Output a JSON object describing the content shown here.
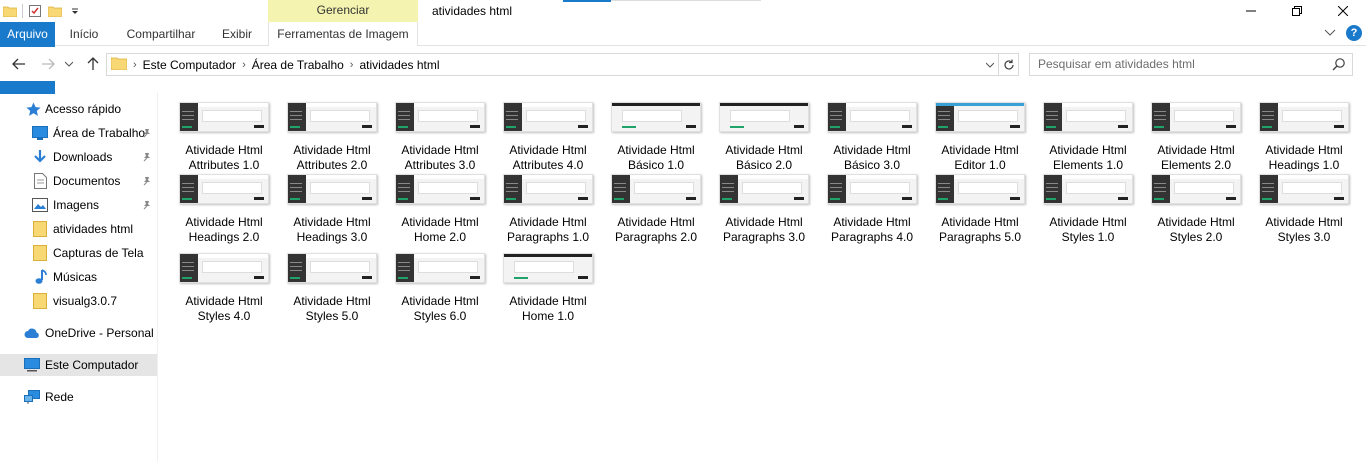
{
  "window": {
    "title": "atividades html",
    "contextual_tab_group": "Gerenciar"
  },
  "ribbon": {
    "tabs": [
      "Arquivo",
      "Início",
      "Compartilhar",
      "Exibir",
      "Ferramentas de Imagem"
    ]
  },
  "address": {
    "crumbs": [
      "Este Computador",
      "Área de Trabalho",
      "atividades html"
    ]
  },
  "search": {
    "placeholder": "Pesquisar em atividades html"
  },
  "sidebar": {
    "items": [
      {
        "label": "Acesso rápido",
        "icon": "star-icon"
      },
      {
        "label": "Área de Trabalho",
        "icon": "desktop-icon",
        "pinned": true
      },
      {
        "label": "Downloads",
        "icon": "download-icon",
        "pinned": true
      },
      {
        "label": "Documentos",
        "icon": "document-icon",
        "pinned": true
      },
      {
        "label": "Imagens",
        "icon": "image-icon",
        "pinned": true
      },
      {
        "label": "atividades html",
        "icon": "folder-icon"
      },
      {
        "label": "Capturas de Tela",
        "icon": "folder-icon"
      },
      {
        "label": "Músicas",
        "icon": "music-icon"
      },
      {
        "label": "visualg3.0.7",
        "icon": "folder-icon"
      },
      {
        "label": "OneDrive - Personal",
        "icon": "cloud-icon"
      },
      {
        "label": "Este Computador",
        "icon": "computer-icon",
        "selected": true
      },
      {
        "label": "Rede",
        "icon": "network-icon"
      }
    ]
  },
  "files": [
    {
      "line1": "Atividade Html",
      "line2": "Attributes 1.0"
    },
    {
      "line1": "Atividade Html",
      "line2": "Attributes 2.0"
    },
    {
      "line1": "Atividade Html",
      "line2": "Attributes 3.0"
    },
    {
      "line1": "Atividade Html",
      "line2": "Attributes 4.0"
    },
    {
      "line1": "Atividade Html",
      "line2": "Básico 1.0"
    },
    {
      "line1": "Atividade Html",
      "line2": "Básico 2.0"
    },
    {
      "line1": "Atividade Html",
      "line2": "Básico 3.0"
    },
    {
      "line1": "Atividade Html",
      "line2": "Editor 1.0"
    },
    {
      "line1": "Atividade Html",
      "line2": "Elements 1.0"
    },
    {
      "line1": "Atividade Html",
      "line2": "Elements 2.0"
    },
    {
      "line1": "Atividade Html",
      "line2": "Headings 1.0"
    },
    {
      "line1": "Atividade Html",
      "line2": "Headings 2.0"
    },
    {
      "line1": "Atividade Html",
      "line2": "Headings 3.0"
    },
    {
      "line1": "Atividade Html",
      "line2": "Home 2.0"
    },
    {
      "line1": "Atividade Html",
      "line2": "Paragraphs 1.0"
    },
    {
      "line1": "Atividade Html",
      "line2": "Paragraphs 2.0"
    },
    {
      "line1": "Atividade Html",
      "line2": "Paragraphs 3.0"
    },
    {
      "line1": "Atividade Html",
      "line2": "Paragraphs 4.0"
    },
    {
      "line1": "Atividade Html",
      "line2": "Paragraphs 5.0"
    },
    {
      "line1": "Atividade Html",
      "line2": "Styles 1.0"
    },
    {
      "line1": "Atividade Html",
      "line2": "Styles 2.0"
    },
    {
      "line1": "Atividade Html",
      "line2": "Styles 3.0"
    },
    {
      "line1": "Atividade Html",
      "line2": "Styles 4.0"
    },
    {
      "line1": "Atividade Html",
      "line2": "Styles 5.0"
    },
    {
      "line1": "Atividade Html",
      "line2": "Styles 6.0"
    },
    {
      "line1": "Atividade Html",
      "line2": "Home 1.0"
    }
  ],
  "colors": {
    "accent": "#1979ca",
    "contextual_tab": "#f4f4b0",
    "folder": "#f8d775",
    "selected_bg": "#e5e5e5"
  }
}
